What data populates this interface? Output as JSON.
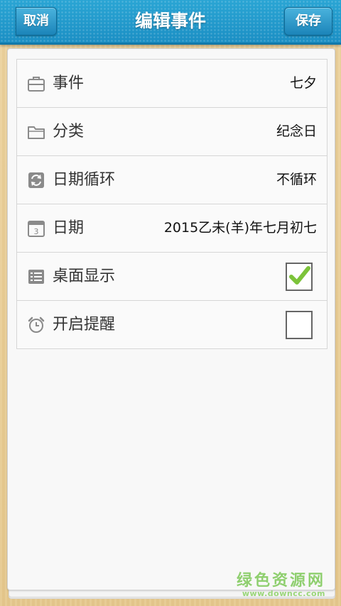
{
  "header": {
    "title": "编辑事件",
    "back_label": "取消",
    "save_label": "保存"
  },
  "rows": [
    {
      "label": "事件",
      "value": "七夕"
    },
    {
      "label": "分类",
      "value": "纪念日"
    },
    {
      "label": "日期循环",
      "value": "不循环"
    },
    {
      "label": "日期",
      "value": "2015乙未(羊)年七月初七"
    },
    {
      "label": "桌面显示",
      "checked": true
    },
    {
      "label": "开启提醒",
      "checked": false
    }
  ],
  "icons": [
    "briefcase-icon",
    "folder-icon",
    "repeat-icon",
    "calendar-icon",
    "list-icon",
    "alarm-clock-icon"
  ],
  "calendar_icon_day": "3",
  "watermark": {
    "main": "绿色资源网",
    "url": "www.downcc.com"
  },
  "colors": {
    "accent": "#1b8fc4",
    "check_green": "#7cc33a"
  }
}
